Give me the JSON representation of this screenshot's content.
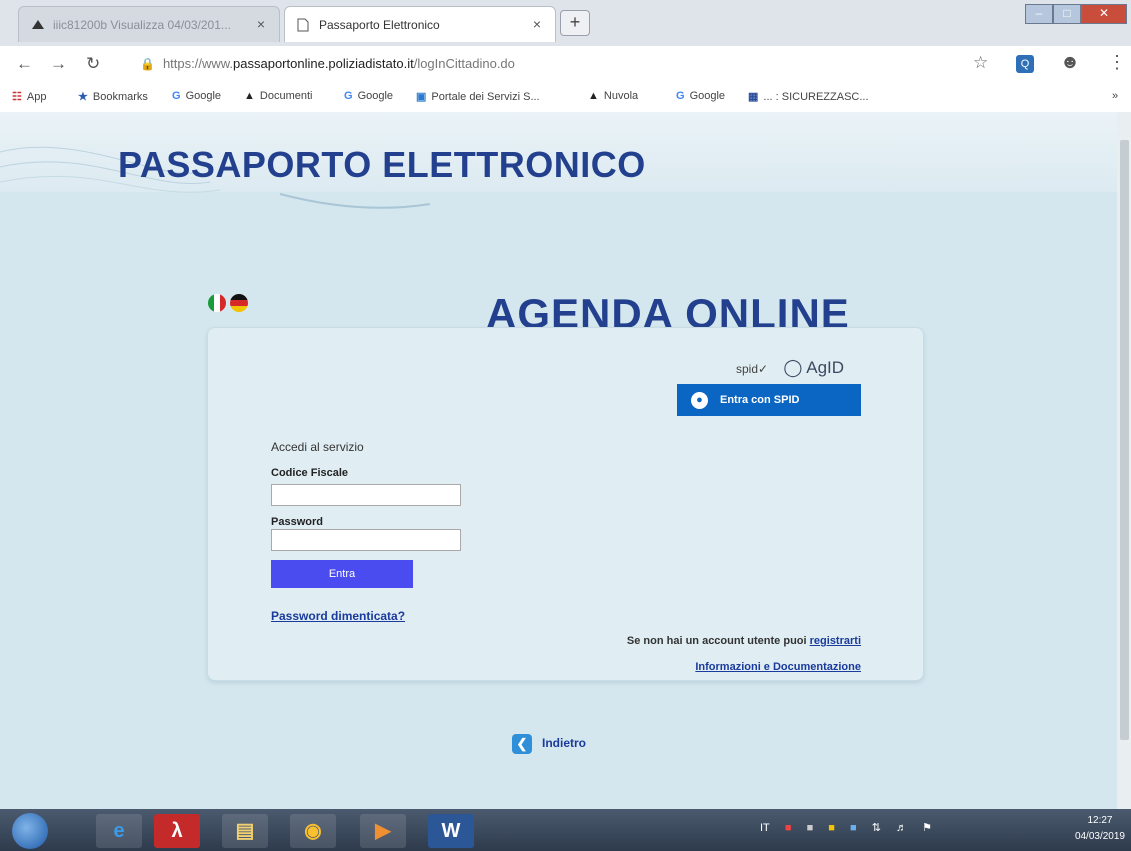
{
  "browser": {
    "tabs": [
      {
        "title": "iiic81200b Visualizza 04/03/201...",
        "active": false
      },
      {
        "title": "Passaporto Elettronico",
        "active": true
      }
    ],
    "new_tab_label": "+",
    "close_label": "×",
    "url_prefix": "https://www.",
    "url_domain": "passaportonline.poliziadistato.it",
    "url_path": "/logInCittadino.do",
    "bookmarks": [
      {
        "icon": "apps-grid-icon",
        "label": "App"
      },
      {
        "icon": "star-icon",
        "label": "Bookmarks"
      },
      {
        "icon": "google-icon",
        "label": "Google"
      },
      {
        "icon": "cloud-icon",
        "label": "Documenti"
      },
      {
        "icon": "google-icon",
        "label": "Google"
      },
      {
        "icon": "portal-icon",
        "label": "Portale dei Servizi S..."
      },
      {
        "icon": "cloud-icon",
        "label": "Nuvola"
      },
      {
        "icon": "google-icon",
        "label": "Google"
      },
      {
        "icon": "document-icon",
        "label": "... : SICUREZZASC..."
      }
    ],
    "overflow_label": "»"
  },
  "page": {
    "site_title": "PASSAPORTO ELETTRONICO",
    "agenda_title": "AGENDA ONLINE",
    "spid_logo_text": "spid✓",
    "agid_logo_text": "AgID",
    "spid_button_label": "Entra con SPID",
    "access_title": "Accedi al servizio",
    "codice_fiscale_label": "Codice Fiscale",
    "codice_fiscale_value": "",
    "password_label": "Password",
    "password_value": "",
    "login_button_label": "Entra",
    "forgot_password_label": "Password dimenticata?",
    "register_prefix": "Se non hai un account utente puoi ",
    "register_link_label": "registrarti",
    "info_link_label": "Informazioni e Documentazione",
    "back_label": "Indietro"
  },
  "taskbar": {
    "language": "IT",
    "time": "12:27",
    "date": "04/03/2019"
  },
  "colors": {
    "brand_blue": "#23408e",
    "spid_blue": "#0b66c3",
    "login_button": "#4a4cf0",
    "page_background": "#d4e7ee"
  }
}
